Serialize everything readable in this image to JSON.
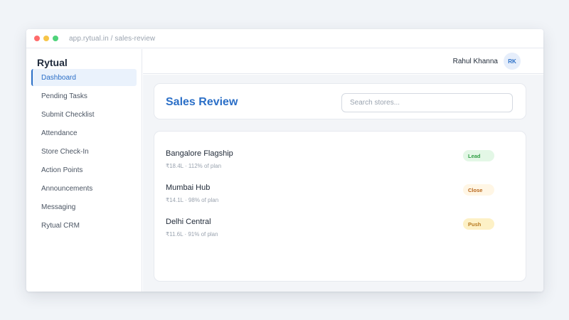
{
  "browser": {
    "url": "app.rytual.in / sales-review"
  },
  "sidebar": {
    "brand": "Rytual",
    "items": [
      {
        "label": "Dashboard",
        "active": true
      },
      {
        "label": "Pending Tasks"
      },
      {
        "label": "Submit Checklist"
      },
      {
        "label": "Attendance"
      },
      {
        "label": "Store Check-In"
      },
      {
        "label": "Action Points"
      },
      {
        "label": "Announcements"
      },
      {
        "label": "Messaging"
      },
      {
        "label": "Rytual CRM"
      }
    ]
  },
  "topbar": {
    "user_name": "Rahul Khanna",
    "avatar_initials": "RK"
  },
  "main": {
    "title": "Sales Review",
    "search": {
      "placeholder": "Search stores...",
      "value": ""
    },
    "stores": [
      {
        "name": "Bangalore Flagship",
        "meta": "₹18.4L · 112% of plan",
        "badge": "Lead",
        "badge_bg": "#e3f7e6",
        "badge_color": "#2f9e44"
      },
      {
        "name": "Mumbai Hub",
        "meta": "₹14.1L · 98% of plan",
        "badge": "Close",
        "badge_bg": "#fff6e5",
        "badge_color": "#b8661a"
      },
      {
        "name": "Delhi Central",
        "meta": "₹11.6L · 91% of plan",
        "badge": "Push",
        "badge_bg": "#fdf1c6",
        "badge_color": "#b7791f"
      }
    ]
  },
  "colors": {
    "accent": "#2b6fc7",
    "background": "#f1f4f8"
  }
}
